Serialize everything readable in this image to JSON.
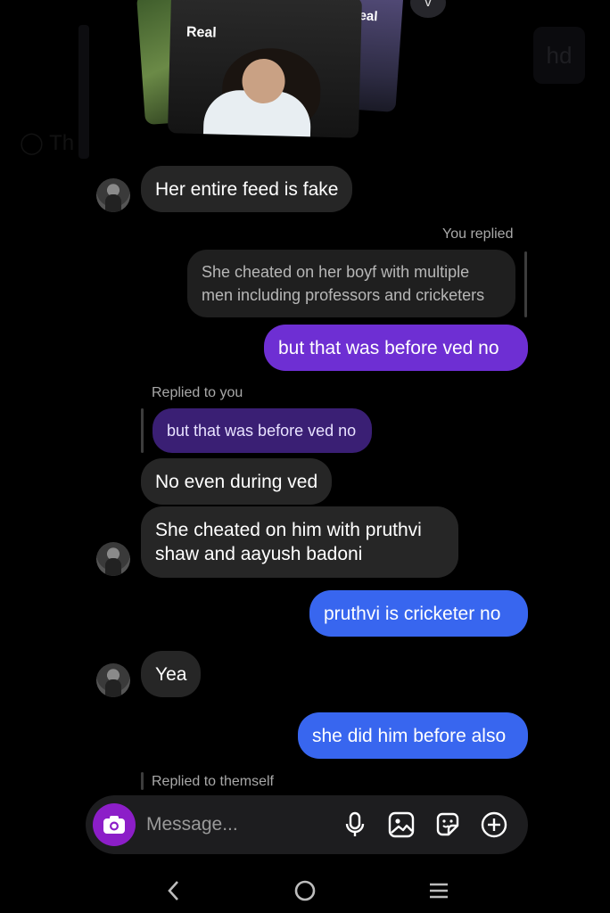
{
  "background": {
    "left_text": "Th",
    "hd_text": "hd"
  },
  "shared_post": {
    "front_label": "Real",
    "back_label": "eal",
    "chevron": "v"
  },
  "messages": [
    {
      "id": "m1",
      "side": "incoming",
      "text": "Her entire feed is fake"
    },
    {
      "id": "m2",
      "side": "outgoing",
      "reply_meta": "You replied",
      "quoted_text": "She cheated on her boyf with multiple men including professors and cricketers",
      "text": "but that was before ved no"
    },
    {
      "id": "m3",
      "side": "incoming",
      "reply_meta": "Replied to you",
      "quoted_text": "but that was before ved no",
      "text": "No even during ved"
    },
    {
      "id": "m4",
      "side": "incoming",
      "text": "She cheated on him with pruthvi shaw and aayush badoni"
    },
    {
      "id": "m5",
      "side": "outgoing",
      "text": "pruthvi is cricketer no"
    },
    {
      "id": "m6",
      "side": "incoming",
      "text": "Yea"
    },
    {
      "id": "m7",
      "side": "outgoing",
      "text": "she did him before also"
    },
    {
      "id": "m8",
      "side": "incoming",
      "reply_meta": "Replied to themself"
    }
  ],
  "quote_lines": {
    "m2_line1": "She cheated on her boyf with multiple",
    "m2_line2": "men including professors and cricketers"
  },
  "m4_lines": {
    "line1": "She cheated on him with pruthvi",
    "line2": "shaw and aayush badoni"
  },
  "composer": {
    "placeholder": "Message...",
    "icons": [
      "camera-icon",
      "microphone-icon",
      "gallery-icon",
      "sticker-icon",
      "add-icon"
    ]
  },
  "navbar": {
    "icons": [
      "back-icon",
      "home-icon",
      "recents-icon"
    ]
  },
  "colors": {
    "background": "#000000",
    "incoming_bubble": "#262626",
    "outgoing_purple": "#6e2fd3",
    "outgoing_blue": "#3866ef",
    "camera_button": "#8c1ec8"
  }
}
